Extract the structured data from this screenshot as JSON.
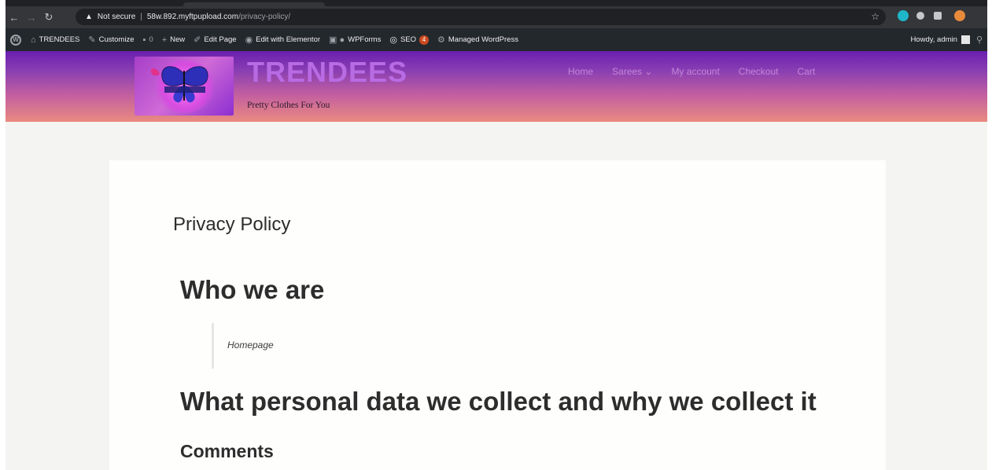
{
  "browser": {
    "security_label": "Not secure",
    "url_host": "58w.892.myftpupload.com",
    "url_path": "/privacy-policy/",
    "separator": "|",
    "warning_glyph": "▲",
    "star_glyph": "☆"
  },
  "admin_bar": {
    "site_name": "TRENDEES",
    "customize": "Customize",
    "comments_count": "0",
    "new": "New",
    "edit_page": "Edit Page",
    "edit_elementor": "Edit with Elementor",
    "wpforms": "WPForms",
    "seo": "SEO",
    "seo_badge": "4",
    "managed_wp": "Managed WordPress",
    "howdy": "Howdy, admin"
  },
  "site": {
    "title": "TRENDEES",
    "tagline": "Pretty Clothes For You",
    "nav": [
      "Home",
      "Sarees ⌄",
      "My account",
      "Checkout",
      "Cart"
    ]
  },
  "content": {
    "page_title": "Privacy Policy",
    "heading_who": "Who we are",
    "quote_text": "Homepage",
    "heading_what": "What personal data we collect and why we collect it",
    "heading_comments": "Comments"
  },
  "colors": {
    "header_top": "#6a1fb0",
    "header_bottom": "#ea8a80",
    "admin_bar": "#23282d",
    "site_title": "#b86be3"
  }
}
